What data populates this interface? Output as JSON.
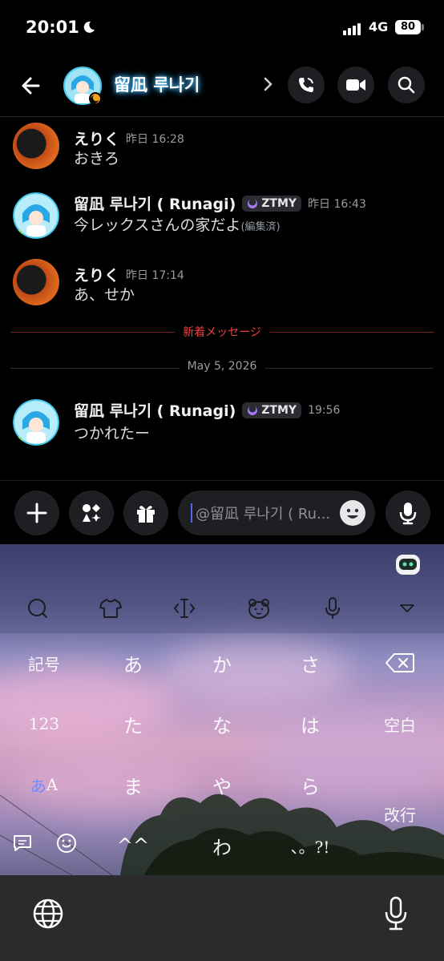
{
  "status_bar": {
    "time": "20:01",
    "network": "4G",
    "battery": "80"
  },
  "header": {
    "channel_name": "留凪 루나기"
  },
  "messages": [
    {
      "author": "えりく",
      "timestamp": "昨日 16:28",
      "text": "おきろ",
      "tag": "",
      "edited": ""
    },
    {
      "author": "留凪 루나기 ( Runagi)",
      "timestamp": "昨日 16:43",
      "text": "今レックスさんの家だよ",
      "tag": "ZTMY",
      "edited": "(編集済)"
    },
    {
      "author": "えりく",
      "timestamp": "昨日 17:14",
      "text": "あ、せか",
      "tag": "",
      "edited": ""
    },
    {
      "author": "留凪 루나기 ( Runagi)",
      "timestamp": "19:56",
      "text": "つかれたー",
      "tag": "ZTMY",
      "edited": ""
    }
  ],
  "dividers": {
    "new_messages": "新着メッセージ",
    "date": "May 5, 2026"
  },
  "composer": {
    "placeholder": "@留凪 루나기 ( Ru..."
  },
  "keyboard": {
    "rows": [
      [
        "記号",
        "あ",
        "か",
        "さ"
      ],
      [
        "123",
        "た",
        "な",
        "は",
        "空白"
      ],
      [
        "あA",
        "ま",
        "や",
        "ら",
        "改行"
      ],
      [
        "^^",
        "わ",
        "、。?!"
      ]
    ],
    "labels": {
      "kigou": "記号",
      "a": "あ",
      "ka": "か",
      "sa": "さ",
      "num": "123",
      "ta": "た",
      "na": "な",
      "ha": "は",
      "space": "空白",
      "kana_a": "あ",
      "kana_A": "A",
      "ma": "ま",
      "ya": "や",
      "ra": "ら",
      "enter": "改行",
      "kao": "^^",
      "wa": "わ",
      "punct": "、。?!"
    }
  },
  "colors": {
    "accent": "#5865f2",
    "new_divider": "#f23f43",
    "background": "#000000"
  }
}
